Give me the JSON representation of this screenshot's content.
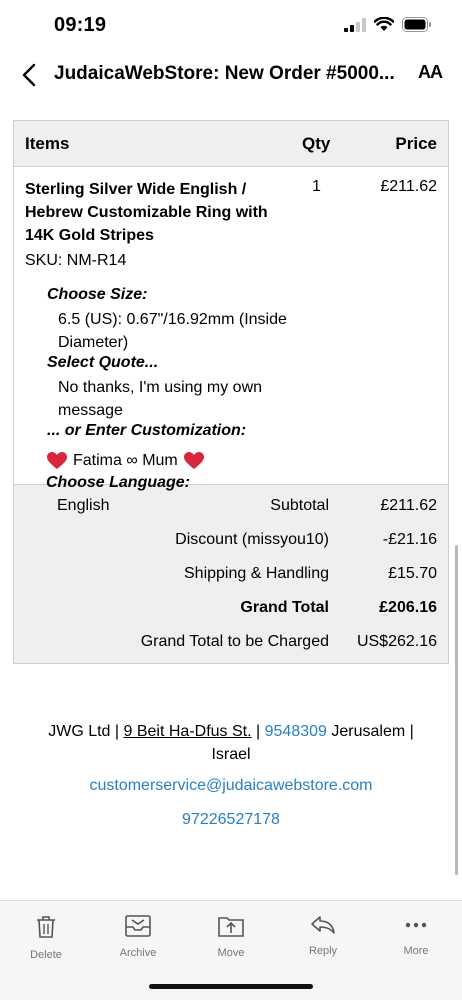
{
  "status": {
    "time": "09:19"
  },
  "nav": {
    "title": "JudaicaWebStore: New Order #5000...",
    "text_size_label": "AA"
  },
  "table": {
    "headers": {
      "items": "Items",
      "qty": "Qty",
      "price": "Price"
    },
    "item": {
      "name": "Sterling Silver Wide English / Hebrew Customizable Ring with 14K Gold Stripes",
      "qty": "1",
      "price": "£211.62",
      "sku": "SKU: NM-R14",
      "options": [
        {
          "title": "Choose Size:",
          "value": "6.5 (US): 0.67\"/16.92mm (Inside Diameter)"
        },
        {
          "title": "Select Quote...",
          "value": "No thanks, I'm using my own message"
        },
        {
          "title": "... or Enter Customization:",
          "value": "Fatima ∞ Mum"
        },
        {
          "title": "Choose Language:",
          "value": "English"
        }
      ]
    },
    "totals": [
      {
        "label": "Subtotal",
        "value": "£211.62"
      },
      {
        "label": "Discount (missyou10)",
        "value": "-£21.16"
      },
      {
        "label": "Shipping & Handling",
        "value": "£15.70"
      },
      {
        "label": "Grand Total",
        "value": "£206.16"
      },
      {
        "label": "Grand Total to be Charged",
        "value": "US$262.16"
      }
    ]
  },
  "footer": {
    "company": "JWG Ltd |",
    "street": "9 Beit Ha-Dfus St.",
    "sep": "|",
    "zip": "9548309",
    "city": "Jerusalem |",
    "country": "Israel",
    "email": "customerservice@judaicawebstore.com",
    "phone": "97226527178"
  },
  "toolbar": {
    "delete": "Delete",
    "archive": "Archive",
    "move": "Move",
    "reply": "Reply",
    "more": "More"
  },
  "colors": {
    "link": "#2a7fc2",
    "heart": "#d7263d"
  }
}
